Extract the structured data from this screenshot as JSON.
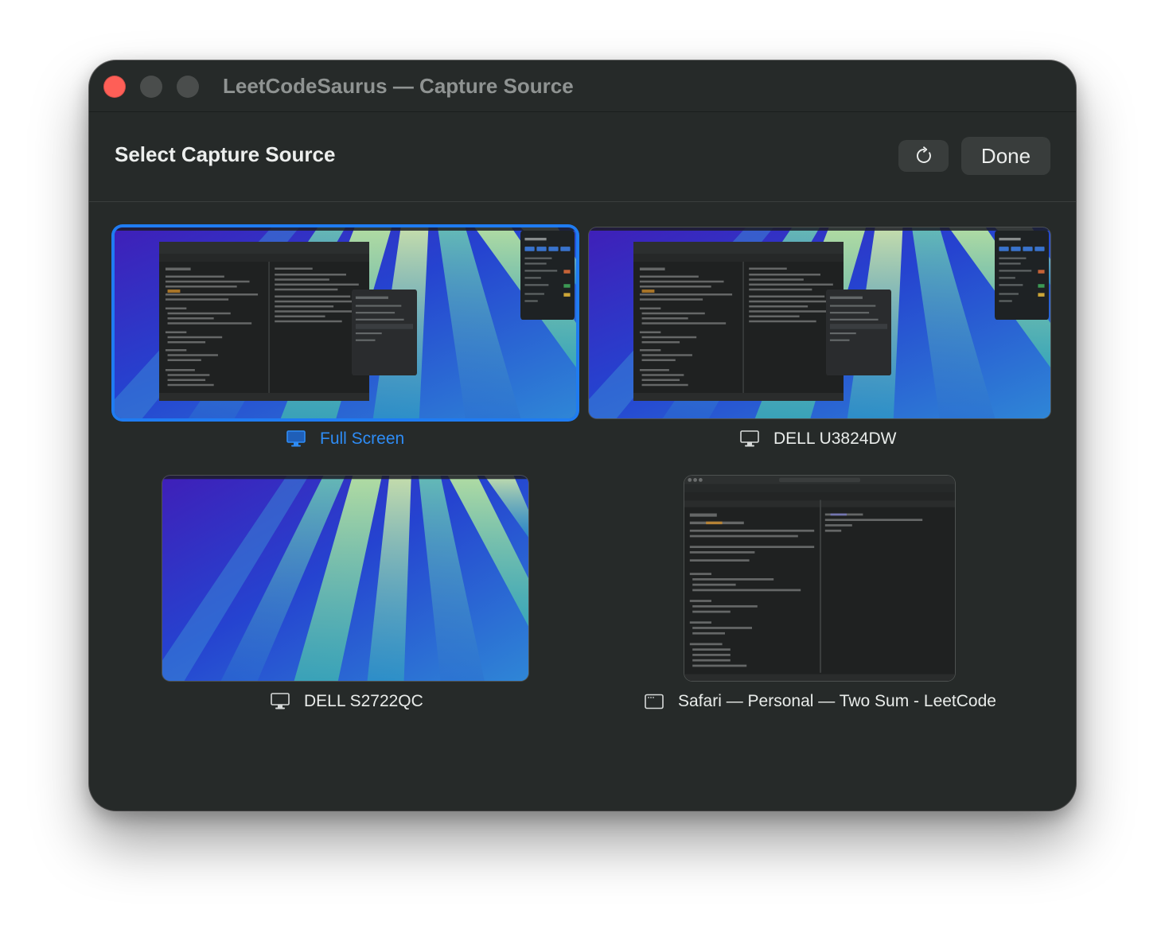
{
  "window": {
    "title": "LeetCodeSaurus — Capture Source"
  },
  "header": {
    "title": "Select Capture Source",
    "refresh_icon": "refresh-icon",
    "done_label": "Done"
  },
  "sources": [
    {
      "label": "Full Screen",
      "icon": "display-icon",
      "selected": true,
      "kind": "screen"
    },
    {
      "label": "DELL U3824DW",
      "icon": "display-icon",
      "selected": false,
      "kind": "screen"
    },
    {
      "label": "DELL S2722QC",
      "icon": "display-icon",
      "selected": false,
      "kind": "screen"
    },
    {
      "label": "Safari — Personal — Two Sum - LeetCode",
      "icon": "window-icon",
      "selected": false,
      "kind": "window"
    }
  ],
  "colors": {
    "window_bg": "#262a29",
    "accent": "#1f7cf2",
    "close_light": "#fe5f57",
    "button_bg": "#393d3c"
  }
}
